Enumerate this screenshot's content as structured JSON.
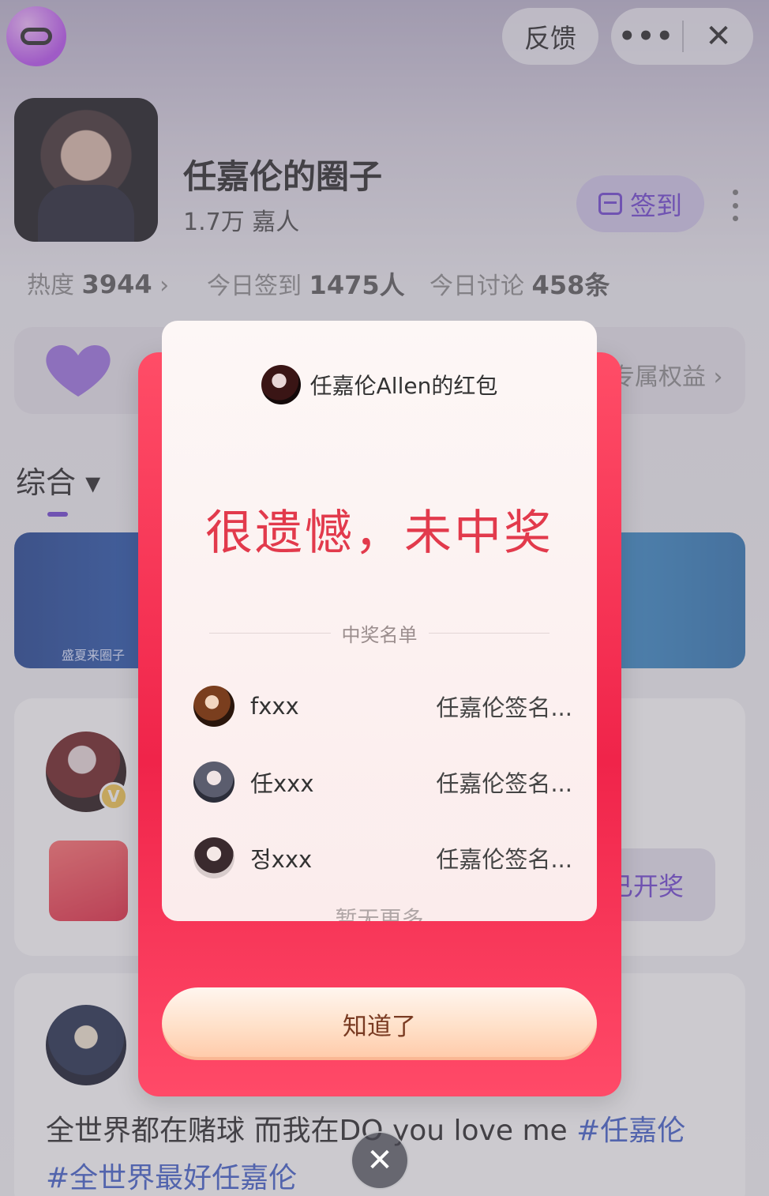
{
  "topbar": {
    "feedback_label": "反馈",
    "more_label": "•••",
    "close_label": "✕"
  },
  "circle": {
    "name": "任嘉伦的圈子",
    "members": "1.7万 嘉人",
    "signin_label": "签到"
  },
  "stats": {
    "heat_label": "热度",
    "heat_value": "3944",
    "heat_arrow": "›",
    "checkin_label": "今日签到",
    "checkin_value": "1475人",
    "discuss_label": "今日讨论",
    "discuss_value": "458条"
  },
  "benefit": {
    "text": "专属权益 ›"
  },
  "tabs": {
    "active": "综合 ▾"
  },
  "banner": {
    "tag": "盛夏来圈子"
  },
  "post1": {
    "lottery_label": "已开奖"
  },
  "post2": {
    "text_plain": "全世界都在赌球 而我在DO you love me ",
    "tag1": "#任嘉伦",
    "tag2": "#全世界最好任嘉伦"
  },
  "modal": {
    "sender_name": "任嘉伦Allen的红包",
    "result": "很遗憾，未中奖",
    "winners_title": "中奖名单",
    "winners": [
      {
        "name": "fxxx",
        "prize": "任嘉伦签名..."
      },
      {
        "name": "任xxx",
        "prize": "任嘉伦签名..."
      },
      {
        "name": "정xxx",
        "prize": "任嘉伦签名..."
      }
    ],
    "no_more": "暂无更多",
    "confirm_label": "知道了",
    "close_label": "✕"
  },
  "colors": {
    "accent": "#6b3fd0",
    "red": "#f0244a",
    "result_red": "#e23a4c"
  }
}
